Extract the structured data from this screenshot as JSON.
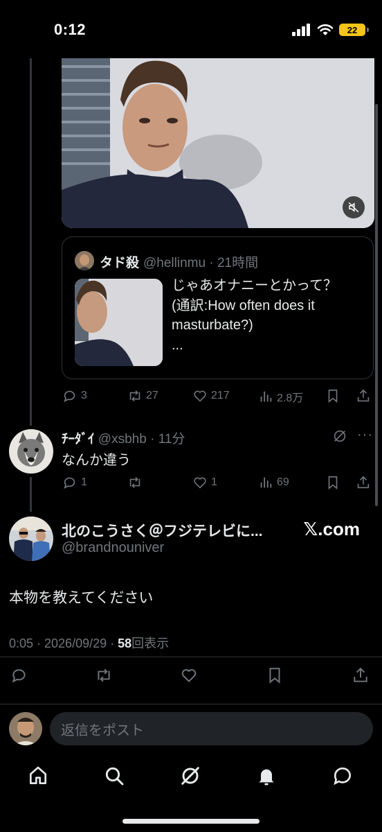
{
  "status_bar": {
    "time": "0:12",
    "battery": "22"
  },
  "quoted_tweet": {
    "name": "タド殺",
    "handle": "@hellinmu",
    "time": "21時間",
    "text": "じゃあオナニーとかって？\n(通訳:How often does it\nmasturbate?)\n..."
  },
  "parent_actions": {
    "replies": "3",
    "reposts": "27",
    "likes": "217",
    "views": "2.8万"
  },
  "reply_tweet": {
    "name": "ﾁｰﾀﾞｲ",
    "handle": "@xsbhb",
    "time": "11分",
    "text": "なんか違う",
    "replies": "1",
    "likes": "1",
    "views": "69"
  },
  "main_tweet": {
    "name": "北のこうさく＠フジテレビに...",
    "handle": "@brandnouniver",
    "text": "本物を教えてください",
    "timestamp": "0:05 · 2026/09/29 · ",
    "views_count": "58",
    "views_label": "回表示",
    "watermark": "𝕏.com"
  },
  "reply_box": {
    "placeholder": "返信をポスト"
  },
  "bottom_nav": [
    "home",
    "search",
    "grok",
    "notifications",
    "messages"
  ]
}
